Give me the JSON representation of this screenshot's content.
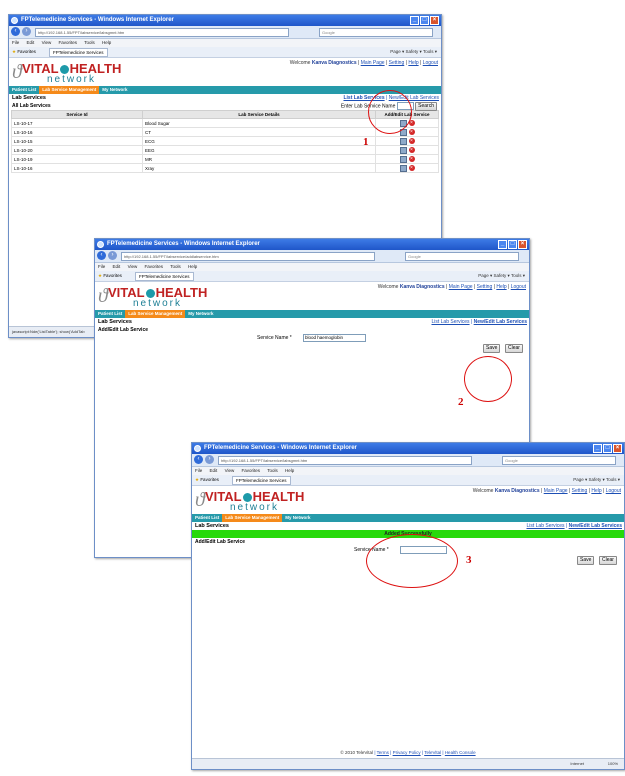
{
  "windows": [
    {
      "title": "FPTelemedicine Services - Windows Internet Explorer",
      "address": "http://192.168.1.55/FPT/labservice/labsgmnt.htm",
      "search_placeholder": "Google",
      "menu": [
        "File",
        "Edit",
        "View",
        "Favorites",
        "Tools",
        "Help"
      ],
      "favorites_label": "Favorites",
      "tab_label": "FPTelemedicine Services",
      "toolbar_tail": "Page ▾  Safety ▾  Tools ▾",
      "welcome_prefix": "Welcome",
      "welcome_user": "Kanva Diagnostics",
      "welcome_links": [
        "Main Page",
        "Setting",
        "Help",
        "Logout"
      ],
      "nav": [
        "Patient List",
        "Lab Service Management",
        "My Network"
      ],
      "section_title": "Lab Services",
      "section_links": [
        "List Lab Services",
        "New/Edit Lab Services"
      ],
      "subheading": "All Lab Services",
      "search_label": "Enter Lab Service Name",
      "search_button": "Search",
      "columns": [
        "Service Id",
        "Lab Service Details",
        "Add/Edit Lab Service"
      ],
      "rows": [
        {
          "id": "LS-10-17",
          "name": "Blood Sugar"
        },
        {
          "id": "LS-10-16",
          "name": "CT"
        },
        {
          "id": "LS-10-15",
          "name": "ECG"
        },
        {
          "id": "LS-10-20",
          "name": "EEG"
        },
        {
          "id": "LS-10-19",
          "name": "MR"
        },
        {
          "id": "LS-10-16",
          "name": "Xray"
        }
      ],
      "status_text": "javascript:Nde('ListTable'); show('AddTab",
      "annotation": "1"
    },
    {
      "title": "FPTelemedicine Services - Windows Internet Explorer",
      "address": "http://192.168.1.55/FPT/labservice/addlabservice.htm",
      "search_placeholder": "Google",
      "menu": [
        "File",
        "Edit",
        "View",
        "Favorites",
        "Tools",
        "Help"
      ],
      "favorites_label": "Favorites",
      "tab_label": "FPTelemedicine Services",
      "toolbar_tail": "Page ▾  Safety ▾  Tools ▾",
      "welcome_prefix": "Welcome",
      "welcome_user": "Kanva Diagnostics",
      "welcome_links": [
        "Main Page",
        "Setting",
        "Help",
        "Logout"
      ],
      "nav": [
        "Patient List",
        "Lab Service Management",
        "My Network"
      ],
      "section_title": "Lab Services",
      "section_links": [
        "List Lab Services",
        "New/Edit Lab Services"
      ],
      "subheading": "Add/Edit Lab Service",
      "service_label": "Service Name *",
      "service_value": "blood haemoglobin",
      "save_button": "Save",
      "clear_button": "Clear",
      "annotation": "2"
    },
    {
      "title": "FPTelemedicine Services - Windows Internet Explorer",
      "address": "http://192.168.1.55/FPT/labservice/labsgmnt.htm",
      "search_placeholder": "Google",
      "menu": [
        "File",
        "Edit",
        "View",
        "Favorites",
        "Tools",
        "Help"
      ],
      "favorites_label": "Favorites",
      "tab_label": "FPTelemedicine Services",
      "toolbar_tail": "Page ▾  Safety ▾  Tools ▾",
      "welcome_prefix": "Welcome",
      "welcome_user": "Kanva Diagnostics",
      "welcome_links": [
        "Main Page",
        "Setting",
        "Help",
        "Logout"
      ],
      "nav": [
        "Patient List",
        "Lab Service Management",
        "My Network"
      ],
      "section_title": "Lab Services",
      "section_links": [
        "List Lab Services",
        "New/Edit Lab Services"
      ],
      "success_message": "Added Successfully",
      "subheading": "Add/Edit Lab Service",
      "service_label": "Service Name *",
      "service_value": "",
      "save_button": "Save",
      "clear_button": "Clear",
      "footer_copy": "© 2010 TeleVital",
      "footer_links": [
        "Terms",
        "Privacy Policy",
        "TeleVital",
        "Health Console"
      ],
      "status_zone": "Internet",
      "zoom": "100%",
      "annotation": "3"
    }
  ],
  "logo": {
    "brand": "VITAL",
    "brand2": "HEALTH",
    "sub": "network"
  },
  "colors": {
    "nav_teal": "#269aaa",
    "nav_active": "#f58a1a",
    "success_green": "#27d90b",
    "annotation_red": "#cc0000",
    "title_blue": "#1f56c9"
  }
}
